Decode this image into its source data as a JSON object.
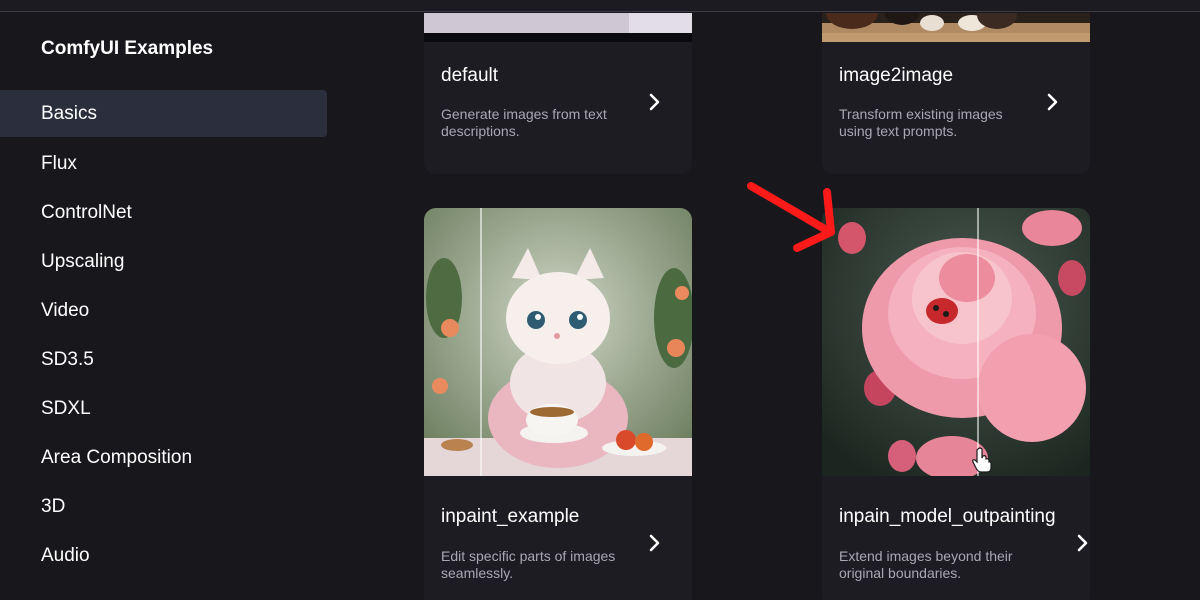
{
  "sidebar": {
    "title": "ComfyUI Examples",
    "items": [
      {
        "label": "Basics",
        "active": true
      },
      {
        "label": "Flux"
      },
      {
        "label": "ControlNet"
      },
      {
        "label": "Upscaling"
      },
      {
        "label": "Video"
      },
      {
        "label": "SD3.5"
      },
      {
        "label": "SDXL"
      },
      {
        "label": "Area Composition"
      },
      {
        "label": "3D"
      },
      {
        "label": "Audio"
      }
    ]
  },
  "cards": [
    {
      "title": "default",
      "description": "Generate images from text descriptions."
    },
    {
      "title": "image2image",
      "description": "Transform existing images using text prompts."
    },
    {
      "title": "inpaint_example",
      "description": "Edit specific parts of images seamlessly."
    },
    {
      "title": "inpain_model_outpainting",
      "description": "Extend images beyond their original boundaries."
    }
  ],
  "icons": {
    "chevron": "chevron-right-icon",
    "annotation": "red-arrow-annotation",
    "cursor": "hand-pointer-cursor"
  },
  "colors": {
    "background": "#18171c",
    "card": "#1d1c22",
    "active_nav": "#2b2e3c",
    "annotation": "#ff1a1a"
  }
}
